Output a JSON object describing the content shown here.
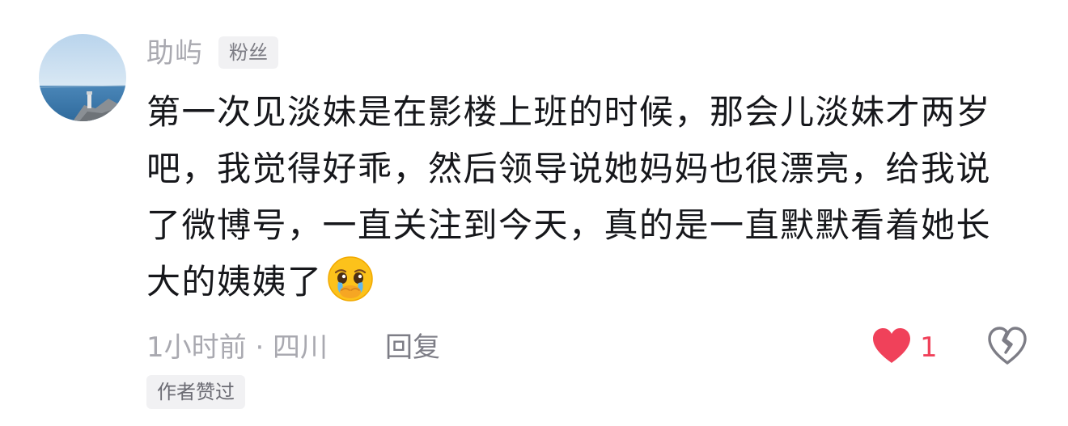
{
  "comment": {
    "avatar_icon": "user-avatar-seaside-photo",
    "username": "助屿",
    "badge": "粉丝",
    "text": "第一次见淡妹是在影楼上班的时候，那会儿淡妹才两岁吧，我觉得好乖，然后领导说她妈妈也很漂亮，给我说了微博号，一直关注到今天，真的是一直默默看着她长大的姨姨了",
    "emoji_icon": "crying-face-emoji",
    "meta": "1小时前 · 四川",
    "reply_label": "回复",
    "like_icon": "heart-filled-icon",
    "like_count": "1",
    "dislike_icon": "broken-heart-icon",
    "author_liked_label": "作者赞过",
    "colors": {
      "like": "#f0415a",
      "muted_text": "#a9a9b0",
      "badge_bg": "#f1f1f3"
    }
  }
}
